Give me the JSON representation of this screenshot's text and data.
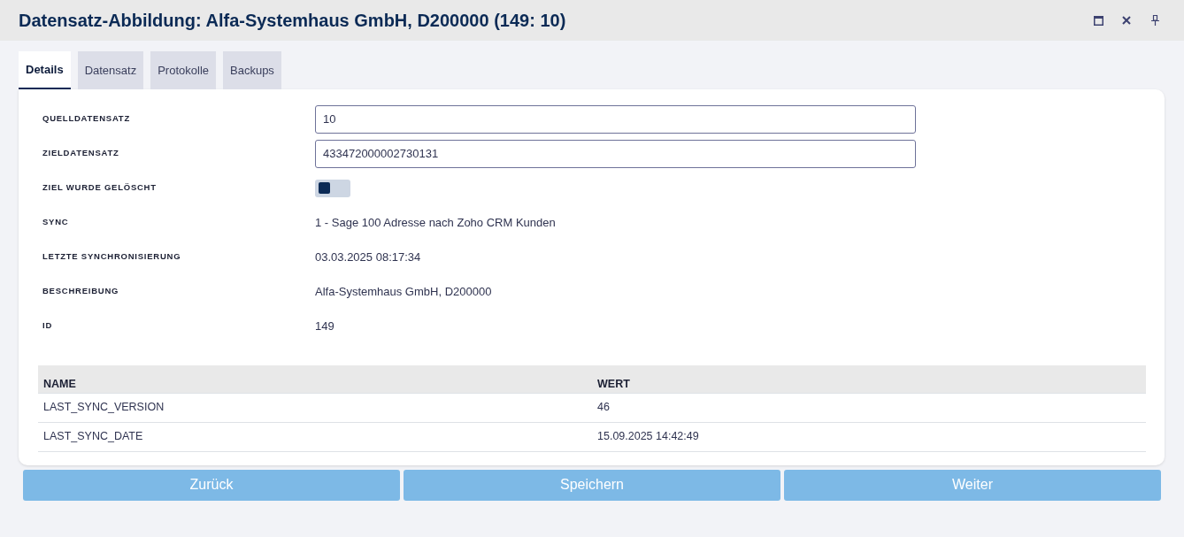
{
  "window": {
    "title": "Datensatz-Abbildung: Alfa-Systemhaus GmbH, D200000 (149: 10)"
  },
  "tabs": [
    {
      "label": "Details",
      "selected": true
    },
    {
      "label": "Datensatz",
      "selected": false
    },
    {
      "label": "Protokolle",
      "selected": false
    },
    {
      "label": "Backups",
      "selected": false
    }
  ],
  "fields": [
    {
      "kind": "input",
      "label": "QUELLDATENSATZ",
      "value": "10"
    },
    {
      "kind": "input",
      "label": "ZIELDATENSATZ",
      "value": "433472000002730131"
    },
    {
      "kind": "toggle",
      "label": "ZIEL WURDE GELÖSCHT",
      "on": false
    },
    {
      "kind": "text",
      "label": "SYNC",
      "value": "1 - Sage 100 Adresse nach Zoho CRM Kunden"
    },
    {
      "kind": "text",
      "label": "LETZTE SYNCHRONISIERUNG",
      "value": "03.03.2025 08:17:34"
    },
    {
      "kind": "text",
      "label": "BESCHREIBUNG",
      "value": "Alfa-Systemhaus GmbH, D200000"
    },
    {
      "kind": "text",
      "label": "ID",
      "value": "149"
    }
  ],
  "table": {
    "columns": [
      "NAME",
      "WERT"
    ],
    "rows": [
      [
        "LAST_SYNC_VERSION",
        "46"
      ],
      [
        "LAST_SYNC_DATE",
        "15.09.2025 14:42:49"
      ]
    ]
  },
  "buttons": [
    "Zurück",
    "Speichern",
    "Weiter"
  ]
}
